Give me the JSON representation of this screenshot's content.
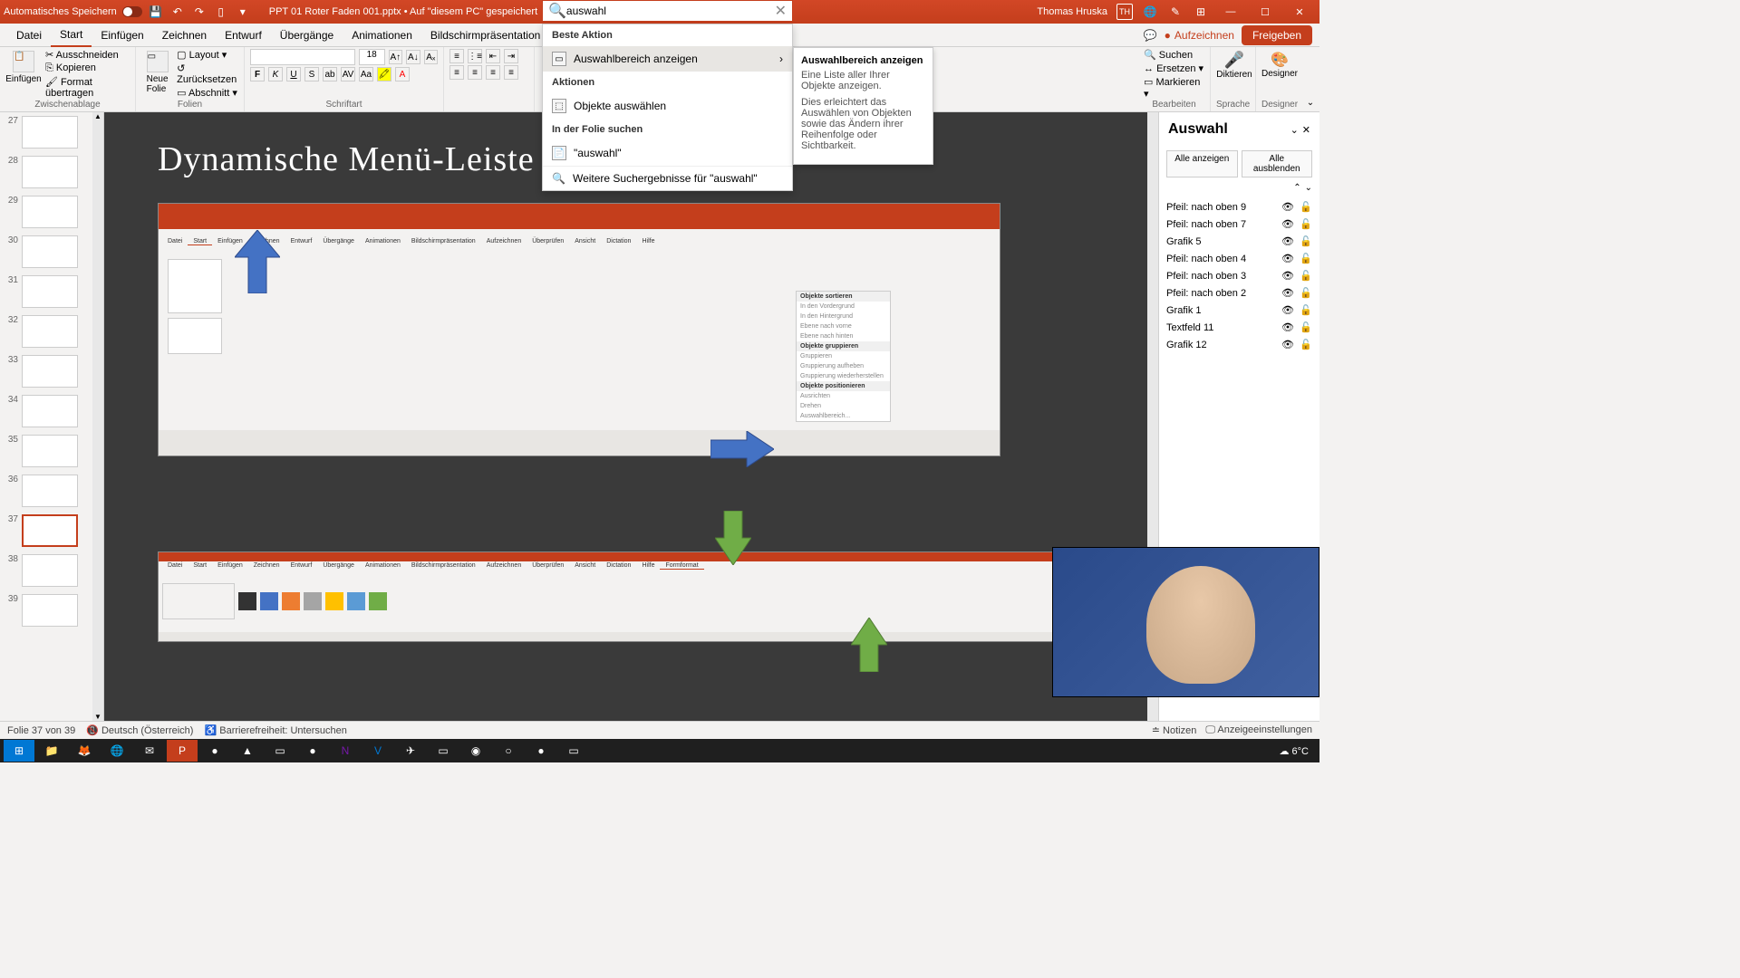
{
  "title_bar": {
    "autosave": "Automatisches Speichern",
    "doc_title": "PPT 01 Roter Faden 001.pptx • Auf \"diesem PC\" gespeichert",
    "user_name": "Thomas Hruska",
    "user_initials": "TH"
  },
  "tabs": [
    "Datei",
    "Start",
    "Einfügen",
    "Zeichnen",
    "Entwurf",
    "Übergänge",
    "Animationen",
    "Bildschirmpräsentation",
    "Aufzeichnen"
  ],
  "active_tab": "Start",
  "ribbon_right": {
    "record": "Aufzeichnen",
    "share": "Freigeben"
  },
  "ribbon": {
    "clipboard": {
      "paste": "Einfügen",
      "cut": "Ausschneiden",
      "copy": "Kopieren",
      "format": "Format übertragen",
      "label": "Zwischenablage"
    },
    "slides": {
      "new": "Neue\nFolie",
      "layout": "Layout",
      "reset": "Zurücksetzen",
      "section": "Abschnitt",
      "label": "Folien"
    },
    "font": {
      "size": "18",
      "label": "Schriftart"
    },
    "editing": {
      "find": "Suchen",
      "replace": "Ersetzen",
      "select": "Markieren",
      "label": "Bearbeiten"
    },
    "dictate": {
      "btn": "Diktieren",
      "label": "Sprache"
    },
    "designer": {
      "btn": "Designer",
      "label": "Designer"
    }
  },
  "search": {
    "query": "auswahl",
    "best_action": "Beste Aktion",
    "best_item": "Auswahlbereich anzeigen",
    "actions_header": "Aktionen",
    "action1": "Objekte auswählen",
    "in_slide": "In der Folie suchen",
    "in_slide_item": "\"auswahl\"",
    "more": "Weitere Suchergebnisse für \"auswahl\""
  },
  "tooltip": {
    "title": "Auswahlbereich anzeigen",
    "desc1": "Eine Liste aller Ihrer Objekte anzeigen.",
    "desc2": "Dies erleichtert das Auswählen von Objekten sowie das Ändern ihrer Reihenfolge oder Sichtbarkeit."
  },
  "thumbnails": [
    {
      "n": 27
    },
    {
      "n": 28
    },
    {
      "n": 29
    },
    {
      "n": 30
    },
    {
      "n": 31
    },
    {
      "n": 32
    },
    {
      "n": 33
    },
    {
      "n": 34
    },
    {
      "n": 35
    },
    {
      "n": 36
    },
    {
      "n": 37
    },
    {
      "n": 38
    },
    {
      "n": 39
    }
  ],
  "selected_thumb": 37,
  "slide": {
    "title": "Dynamische Menü-Leiste",
    "fake_tabs": [
      "Datei",
      "Start",
      "Einfügen",
      "Zeichnen",
      "Entwurf",
      "Übergänge",
      "Animationen",
      "Bildschirmpräsentation",
      "Aufzeichnen",
      "Überprüfen",
      "Ansicht",
      "Dictation",
      "Hilfe"
    ],
    "fake_menu": {
      "h1": "Objekte sortieren",
      "i1": "In den Vordergrund",
      "i2": "In den Hintergrund",
      "i3": "Ebene nach vorne",
      "i4": "Ebene nach hinten",
      "h2": "Objekte gruppieren",
      "i5": "Gruppieren",
      "i6": "Gruppierung aufheben",
      "i7": "Gruppierung wiederherstellen",
      "h3": "Objekte positionieren",
      "i8": "Ausrichten",
      "i9": "Drehen",
      "i10": "Auswahlbereich..."
    },
    "fake_tabs2": [
      "Datei",
      "Start",
      "Einfügen",
      "Zeichnen",
      "Entwurf",
      "Übergänge",
      "Animationen",
      "Bildschirmpräsentation",
      "Aufzeichnen",
      "Überprüfen",
      "Ansicht",
      "Dictation",
      "Hilfe",
      "Formformat"
    ]
  },
  "selection_pane": {
    "title": "Auswahl",
    "show_all": "Alle anzeigen",
    "hide_all": "Alle ausblenden",
    "items": [
      "Pfeil: nach oben 9",
      "Pfeil: nach oben 7",
      "Grafik 5",
      "Pfeil: nach oben 4",
      "Pfeil: nach oben 3",
      "Pfeil: nach oben 2",
      "Grafik 1",
      "Textfeld 11",
      "Grafik 12"
    ]
  },
  "status": {
    "slide_info": "Folie 37 von 39",
    "language": "Deutsch (Österreich)",
    "accessibility": "Barrierefreiheit: Untersuchen",
    "notes": "Notizen",
    "display": "Anzeigeeinstellungen"
  },
  "taskbar": {
    "weather": "6°C"
  }
}
